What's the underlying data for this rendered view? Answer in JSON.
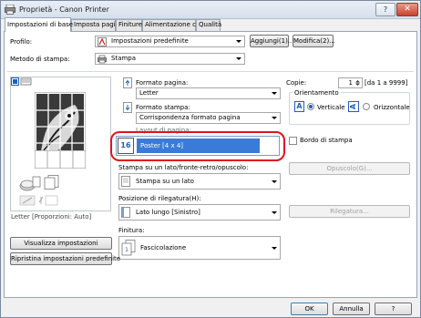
{
  "window": {
    "title": "Proprietà - Canon Printer",
    "help_glyph": "?",
    "close_glyph": "✕"
  },
  "tabs": [
    {
      "label": "Impostazioni di base"
    },
    {
      "label": "Imposta pagina"
    },
    {
      "label": "Finiture"
    },
    {
      "label": "Alimentazione carta"
    },
    {
      "label": "Qualità"
    }
  ],
  "profile": {
    "label": "Profilo:",
    "value": "Impostazioni predefinite",
    "add_button": "Aggiungi(1)...",
    "edit_button": "Modifica(2)..."
  },
  "output_method": {
    "label": "Metodo di stampa:",
    "value": "Stampa"
  },
  "preview": {
    "caption": "Letter [Proporzioni: Auto]"
  },
  "page_size": {
    "label": "Formato pagina:",
    "value": "Letter"
  },
  "output_size": {
    "label": "Formato stampa:",
    "value": "Corrispondenza formato pagina"
  },
  "copies": {
    "label": "Copie:",
    "value": "1",
    "range": "[da 1 a 9999]"
  },
  "orientation": {
    "label": "Orientamento",
    "portrait": "Verticale",
    "landscape": "Orizzontale",
    "selected": "portrait"
  },
  "page_layout": {
    "label": "Layout di pagina:",
    "icon_text": "16",
    "value": "Poster [4 x 4]",
    "page_border_label": "Bordo di stampa"
  },
  "print_style": {
    "label": "Stampa su un lato/fronte-retro/opuscolo:",
    "value": "Stampa su un lato",
    "booklet_button": "Opuscolo(G)..."
  },
  "binding": {
    "label": "Posizione di rilegatura(H):",
    "value": "Lato lungo [Sinistro]",
    "gutter_button": "Rilegatura..."
  },
  "finishing": {
    "label": "Finitura:",
    "value": "Fascicolazione"
  },
  "left_buttons": {
    "view_settings": "Visualizza impostazioni",
    "restore_defaults": "Ripristina impostazioni predefinite"
  },
  "footer": {
    "ok": "OK",
    "cancel": "Annulla",
    "help": "?"
  },
  "colors": {
    "highlight_ring": "#e0141c",
    "selection_bg": "#3b7bd8",
    "accent": "#1f5fbf"
  }
}
